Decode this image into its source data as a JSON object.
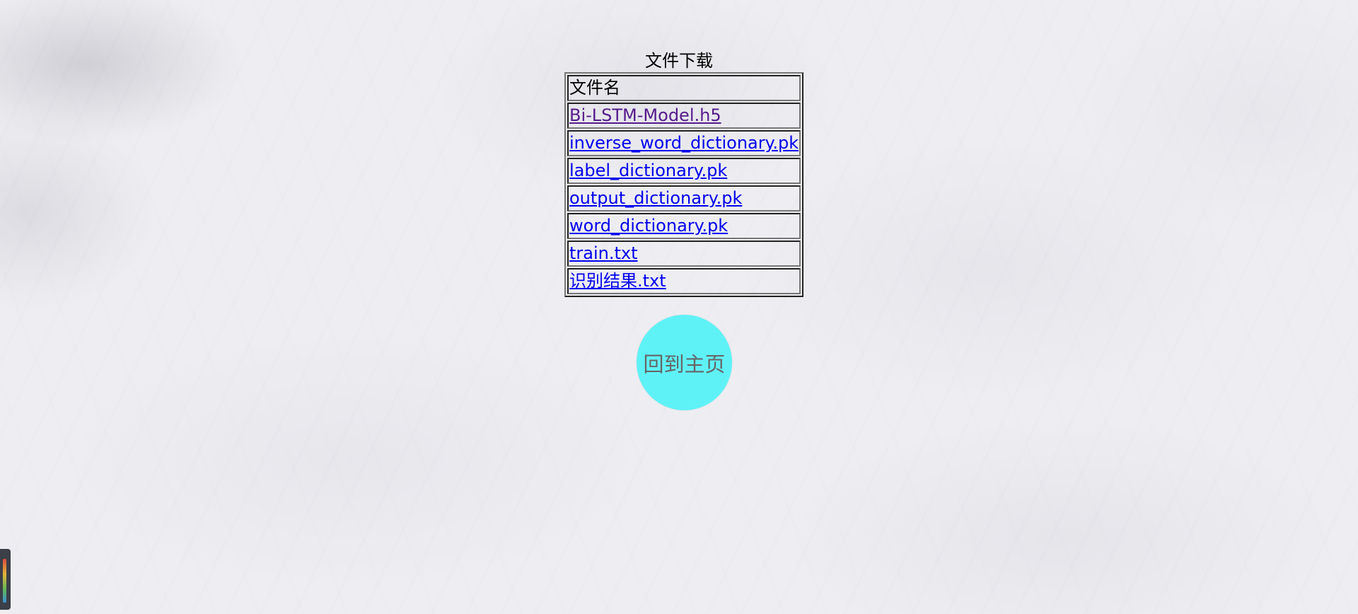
{
  "page": {
    "caption": "文件下载",
    "table_header": "文件名",
    "files": [
      {
        "label": "Bi-LSTM-Model.h5",
        "visited": true
      },
      {
        "label": "inverse_word_dictionary.pk",
        "visited": false
      },
      {
        "label": "label_dictionary.pk",
        "visited": false
      },
      {
        "label": "output_dictionary.pk",
        "visited": false
      },
      {
        "label": "word_dictionary.pk",
        "visited": false
      },
      {
        "label": "train.txt",
        "visited": false
      },
      {
        "label": "识别结果.txt",
        "visited": false
      }
    ],
    "home_button_label": "回到主页"
  },
  "colors": {
    "link": "#0000ee",
    "visited_link": "#551a8b",
    "home_button_bg": "#5ef2f7",
    "home_button_text": "#666666"
  }
}
